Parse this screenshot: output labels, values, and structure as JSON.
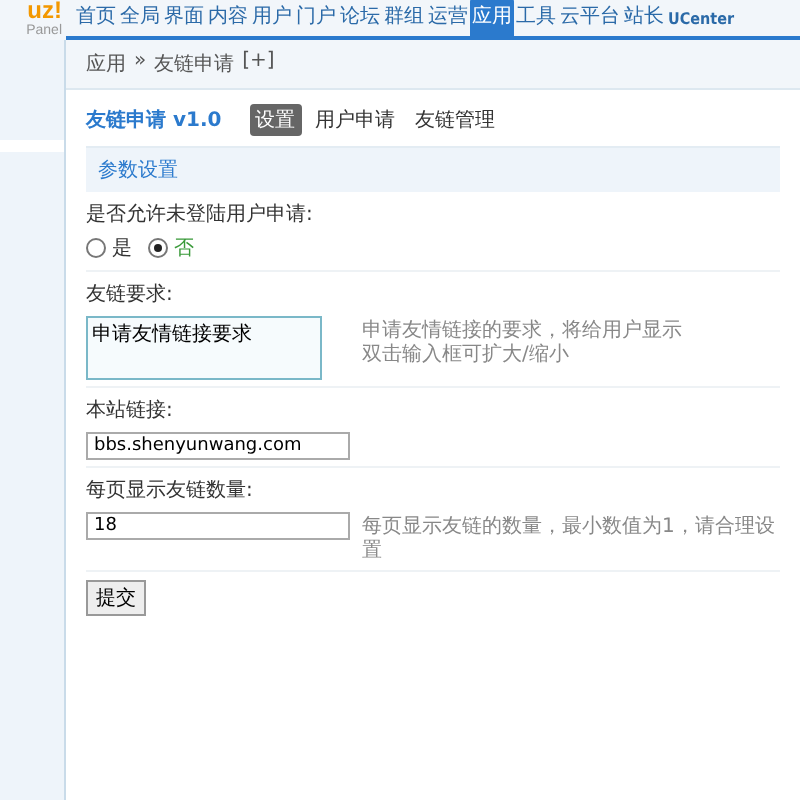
{
  "logo": {
    "mark": "uz!",
    "subtitle": "Panel"
  },
  "nav": [
    {
      "label": "首页",
      "selected": false
    },
    {
      "label": "全局",
      "selected": false
    },
    {
      "label": "界面",
      "selected": false
    },
    {
      "label": "内容",
      "selected": false
    },
    {
      "label": "用户",
      "selected": false
    },
    {
      "label": "门户",
      "selected": false
    },
    {
      "label": "论坛",
      "selected": false
    },
    {
      "label": "群组",
      "selected": false
    },
    {
      "label": "运营",
      "selected": false
    },
    {
      "label": "应用",
      "selected": true
    },
    {
      "label": "工具",
      "selected": false
    },
    {
      "label": "云平台",
      "selected": false
    },
    {
      "label": "站长",
      "selected": false
    },
    {
      "label": "UCenter",
      "selected": false
    }
  ],
  "breadcrumb": {
    "items": [
      "应用",
      "友链申请"
    ],
    "separator": "»",
    "add": "[+]"
  },
  "plugin": {
    "title": "友链申请 v1.0",
    "tabs": [
      {
        "label": "设置",
        "selected": true
      },
      {
        "label": "用户申请",
        "selected": false
      },
      {
        "label": "友链管理",
        "selected": false
      }
    ]
  },
  "section": "参数设置",
  "fields": [
    {
      "kind": "radio",
      "label": "是否允许未登陆用户申请:",
      "options": [
        {
          "label": "是",
          "selected": false
        },
        {
          "label": "否",
          "selected": true
        }
      ]
    },
    {
      "kind": "textarea",
      "label": "友链要求:",
      "value": "申请友情链接要求",
      "hint": [
        "申请友情链接的要求，将给用户显示",
        "双击输入框可扩大/缩小"
      ]
    },
    {
      "kind": "text",
      "label": "本站链接:",
      "value": "bbs.shenyunwang.com"
    },
    {
      "kind": "text",
      "label": "每页显示友链数量:",
      "value": "18",
      "hint": [
        "每页显示友链的数量，最小数值为1，请合理设置"
      ]
    }
  ],
  "submit": "提交"
}
